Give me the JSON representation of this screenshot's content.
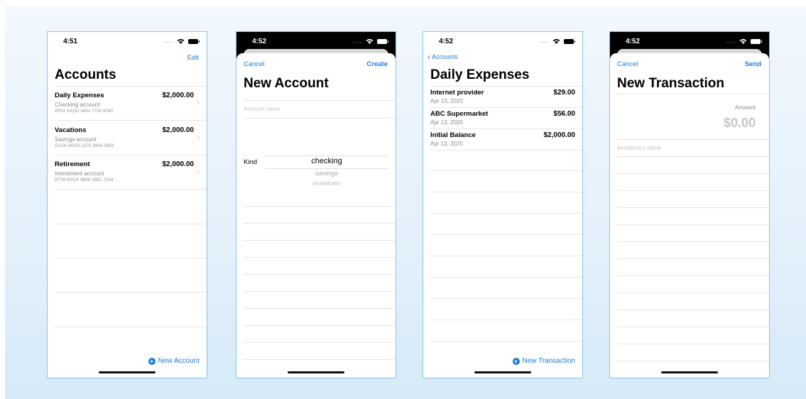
{
  "screens": {
    "accounts": {
      "time": "4:51",
      "edit_label": "Edit",
      "title": "Accounts",
      "accounts": [
        {
          "name": "Daily Expenses",
          "kind": "Checking account",
          "iban": "ZP01 XXQU 4811 7732 6742",
          "balance": "$2,000.00"
        },
        {
          "name": "Vacations",
          "kind": "Savings account",
          "iban": "GU14 DGRJ 2370 3850 0503",
          "balance": "$2,000.00"
        },
        {
          "name": "Retirement",
          "kind": "Investment account",
          "iban": "BT34 EHUX 9838 1852 7104",
          "balance": "$2,000.00"
        }
      ],
      "add_label": "New Account"
    },
    "new_account": {
      "time": "4:52",
      "cancel_label": "Cancel",
      "create_label": "Create",
      "title": "New Account",
      "name_placeholder": "Account name",
      "kind_label": "Kind",
      "kind_options": [
        "checking",
        "savings",
        "investment"
      ],
      "kind_selected": "checking"
    },
    "daily_expenses": {
      "time": "4:52",
      "back_label": "Accounts",
      "title": "Daily Expenses",
      "transactions": [
        {
          "name": "Internet provider",
          "date": "Apr 13, 2020",
          "amount": "$29.00"
        },
        {
          "name": "ABC Supermarket",
          "date": "Apr 13, 2020",
          "amount": "$56.00"
        },
        {
          "name": "Initial Balance",
          "date": "Apr 13, 2020",
          "amount": "$2,000.00"
        }
      ],
      "add_label": "New Transaction"
    },
    "new_transaction": {
      "time": "4:52",
      "cancel_label": "Cancel",
      "send_label": "Send",
      "title": "New Transaction",
      "amount_label": "Amount",
      "amount_value": "$0.00",
      "beneficiary_placeholder": "Beneficiary name"
    }
  },
  "colors": {
    "accent": "#1f7bd6",
    "frame_border": "#8ec0ea",
    "separator": "#e6e6e6",
    "secondary_text": "#8a8a8a"
  },
  "icons": [
    "wifi-icon",
    "battery-icon",
    "chevron-right-icon",
    "chevron-left-icon",
    "plus-circle-icon"
  ]
}
